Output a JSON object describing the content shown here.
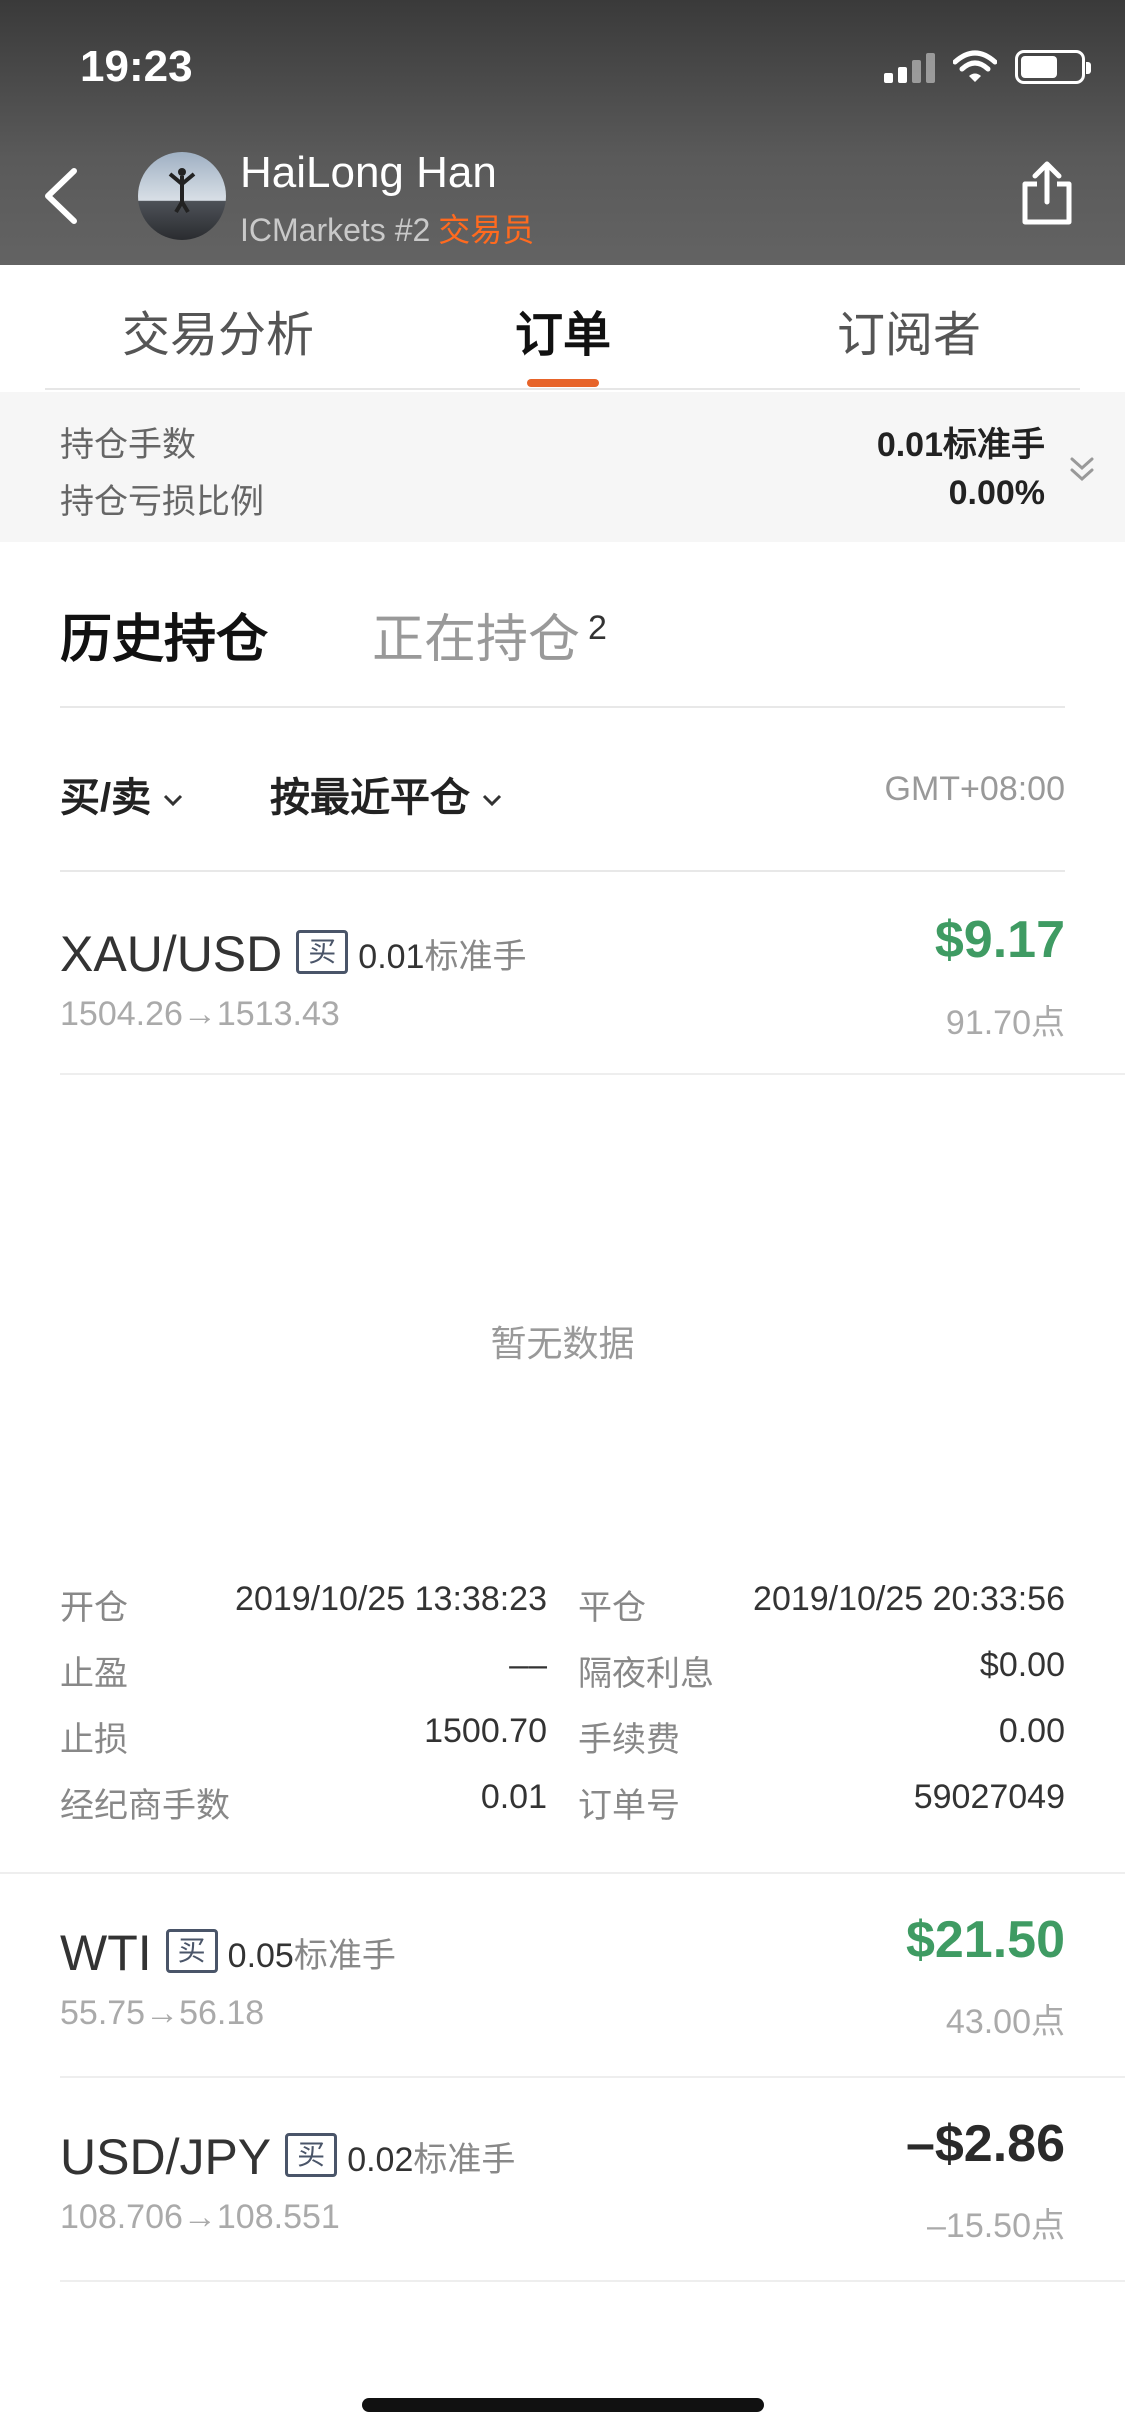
{
  "status_bar": {
    "time": "19:23"
  },
  "header": {
    "name": "HaiLong Han",
    "broker": "ICMarkets #2",
    "role": "交易员"
  },
  "tabs": [
    {
      "label": "交易分析",
      "active": false
    },
    {
      "label": "订单",
      "active": true
    },
    {
      "label": "订阅者",
      "active": false
    }
  ],
  "summary": {
    "lots_label": "持仓手数",
    "lots_value": "0.01标准手",
    "loss_label": "持仓亏损比例",
    "loss_value": "0.00%"
  },
  "subtabs": {
    "history": "历史持仓",
    "open": "正在持仓",
    "open_count": "2"
  },
  "filters": {
    "side": "买/卖",
    "sort": "按最近平仓",
    "timezone": "GMT+08:00"
  },
  "empty_text": "暂无数据",
  "orders": [
    {
      "symbol": "XAU/USD",
      "side": "买",
      "lots": "0.01",
      "lots_unit": "标准手",
      "path": "1504.26→1513.43",
      "pnl": "$9.17",
      "points": "91.70点"
    },
    {
      "symbol": "WTI",
      "side": "买",
      "lots": "0.05",
      "lots_unit": "标准手",
      "path": "55.75→56.18",
      "pnl": "$21.50",
      "points": "43.00点"
    },
    {
      "symbol": "USD/JPY",
      "side": "买",
      "lots": "0.02",
      "lots_unit": "标准手",
      "path": "108.706→108.551",
      "pnl": "–$2.86",
      "points": "–15.50点"
    }
  ],
  "detail": {
    "open_label": "开仓",
    "open_value": "2019/10/25 13:38:23",
    "close_label": "平仓",
    "close_value": "2019/10/25 20:33:56",
    "tp_label": "止盈",
    "tp_value": "––",
    "swap_label": "隔夜利息",
    "swap_value": "$0.00",
    "sl_label": "止损",
    "sl_value": "1500.70",
    "fee_label": "手续费",
    "fee_value": "0.00",
    "broker_lots_label": "经纪商手数",
    "broker_lots_value": "0.01",
    "order_no_label": "订单号",
    "order_no_value": "59027049"
  },
  "colors": {
    "accent": "#e7642a",
    "profit": "#3f9b63",
    "role": "#ff6a1f"
  }
}
